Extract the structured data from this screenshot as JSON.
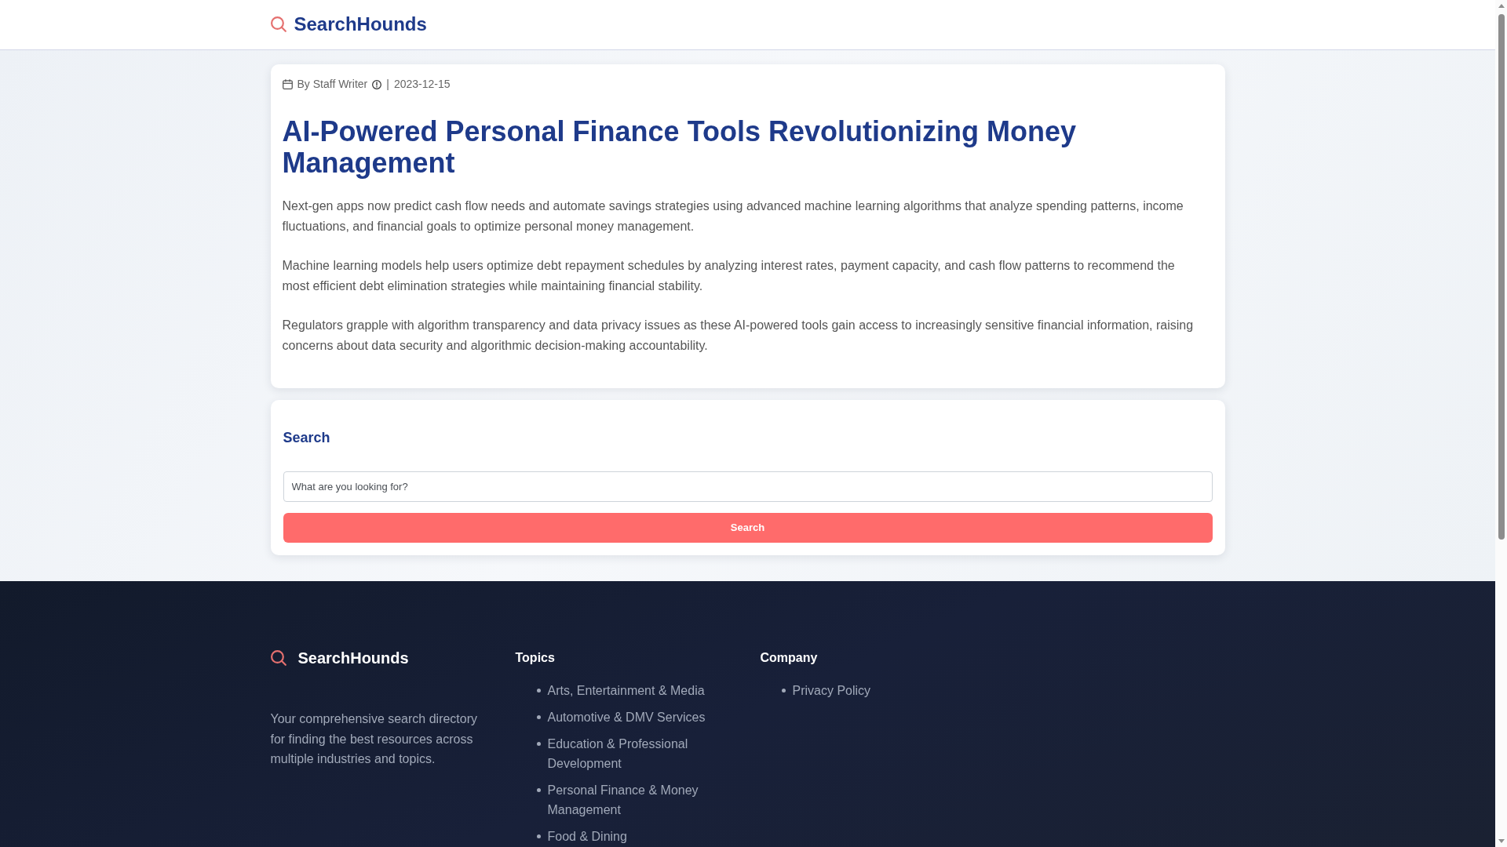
{
  "header": {
    "brand": "SearchHounds"
  },
  "article": {
    "meta": {
      "author": "By Staff Writer",
      "separator": "|",
      "date": "2023-12-15"
    },
    "title": "AI-Powered Personal Finance Tools Revolutionizing Money Management",
    "paragraphs": [
      "Next-gen apps now predict cash flow needs and automate savings strategies using advanced machine learning algorithms that analyze spending patterns, income fluctuations, and financial goals to optimize personal money management.",
      "Machine learning models help users optimize debt repayment schedules by analyzing interest rates, payment capacity, and cash flow patterns to recommend the most efficient debt elimination strategies while maintaining financial stability.",
      "Regulators grapple with algorithm transparency and data privacy issues as these AI-powered tools gain access to increasingly sensitive financial information, raising concerns about data security and algorithmic decision-making accountability."
    ]
  },
  "search_panel": {
    "heading": "Search",
    "placeholder": "What are you looking for?",
    "button": "Search"
  },
  "footer": {
    "brand": "SearchHounds",
    "description": "Your comprehensive search directory for finding the best resources across multiple industries and topics.",
    "columns": [
      {
        "heading": "Topics",
        "links": [
          "Arts, Entertainment & Media",
          "Automotive & DMV Services",
          "Education & Professional Development",
          "Personal Finance & Money Management",
          "Food & Dining"
        ]
      },
      {
        "heading": "Company",
        "links": [
          "Privacy Policy"
        ]
      }
    ]
  }
}
